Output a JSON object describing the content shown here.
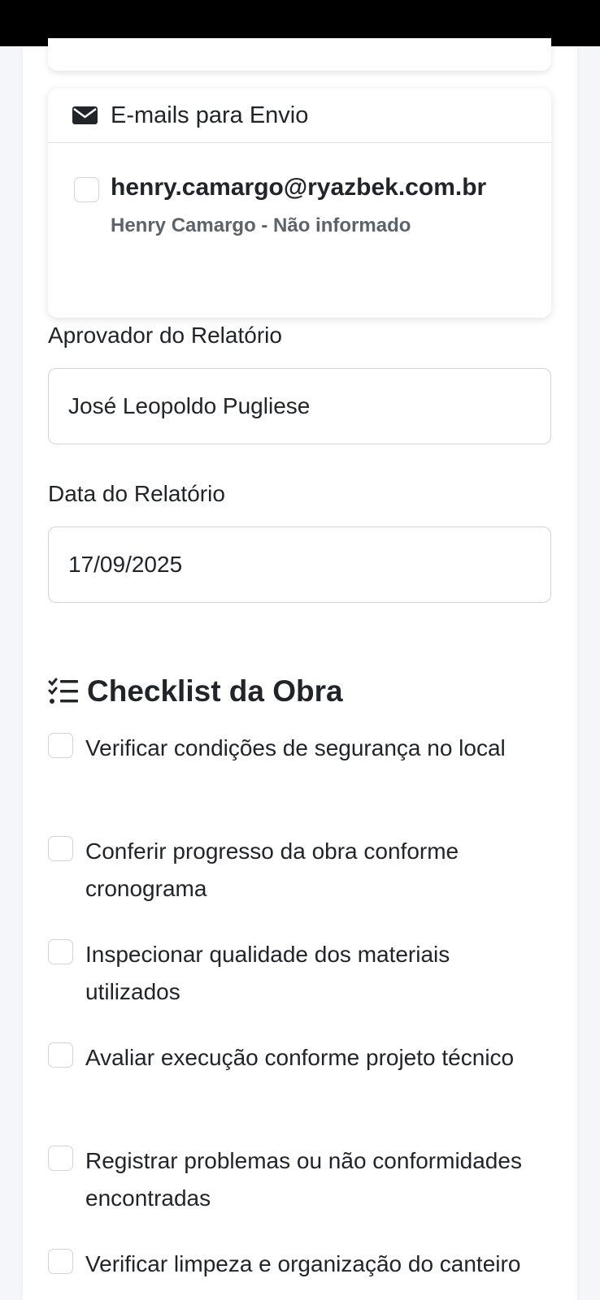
{
  "emails_card": {
    "title": "E-mails para Envio",
    "icon": "envelope-icon",
    "items": [
      {
        "email": "henry.camargo@ryazbek.com.br",
        "subtitle": "Henry Camargo - Não informado",
        "checked": false
      }
    ]
  },
  "approver": {
    "label": "Aprovador do Relatório",
    "value": "José Leopoldo Pugliese"
  },
  "report_date": {
    "label": "Data do Relatório",
    "value": "17/09/2025"
  },
  "checklist": {
    "title": "Checklist da Obra",
    "icon": "list-check-icon",
    "items": [
      {
        "label": "Verificar condições de segurança no local",
        "checked": false
      },
      {
        "label": "Conferir progresso da obra conforme cronograma",
        "checked": false
      },
      {
        "label": "Inspecionar qualidade dos materiais utilizados",
        "checked": false
      },
      {
        "label": "Avaliar execução conforme projeto técnico",
        "checked": false
      },
      {
        "label": "Registrar problemas ou não conformidades encontradas",
        "checked": false
      },
      {
        "label": "Verificar limpeza e organização do canteiro",
        "checked": false
      }
    ]
  },
  "colors": {
    "status_bar": "#000000",
    "background": "#f4f6f9",
    "card": "#ffffff",
    "border": "#ced4da",
    "text": "#212529",
    "muted": "#5c636a"
  }
}
